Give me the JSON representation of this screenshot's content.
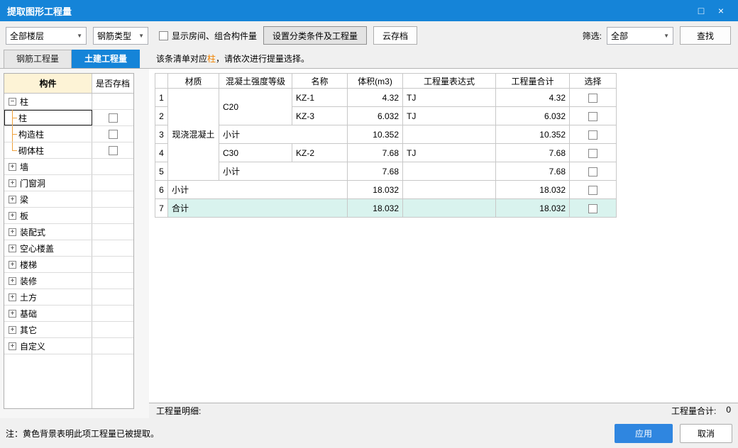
{
  "window": {
    "title": "提取图形工程量"
  },
  "icons": {
    "maximize": "□",
    "close": "×",
    "dropdown_arrow": "▼",
    "collapse": "−",
    "expand": "+"
  },
  "colors": {
    "titlebar_blue": "#1584d8",
    "active_tab_blue": "#1584d8",
    "apply_button_blue": "#2f86e0",
    "component_header_bg": "#fdf3d6",
    "total_row_highlight": "#d9f3ee",
    "tree_connector_orange": "#efa23d",
    "notice_highlight_orange": "#f08200"
  },
  "toolbar": {
    "floor_dropdown": "全部楼层",
    "rebar_dropdown": "钢筋类型",
    "show_checkbox_label": "显示房间、组合构件量",
    "set_category_button": "设置分类条件及工程量",
    "cloud_archive_button": "云存档",
    "filter_label": "筛选:",
    "filter_dropdown": "全部",
    "search_button": "查找"
  },
  "tabs": {
    "rebar": "钢筋工程量",
    "civil": "土建工程量"
  },
  "tree": {
    "col_component": "构件",
    "col_archived": "是否存档",
    "items": [
      {
        "label": "柱"
      },
      {
        "label": "柱"
      },
      {
        "label": "构造柱"
      },
      {
        "label": "砌体柱"
      },
      {
        "label": "墙"
      },
      {
        "label": "门窗洞"
      },
      {
        "label": "梁"
      },
      {
        "label": "板"
      },
      {
        "label": "装配式"
      },
      {
        "label": "空心楼盖"
      },
      {
        "label": "楼梯"
      },
      {
        "label": "装修"
      },
      {
        "label": "土方"
      },
      {
        "label": "基础"
      },
      {
        "label": "其它"
      },
      {
        "label": "自定义"
      }
    ]
  },
  "main": {
    "notice_prefix": "该条清单对应",
    "notice_highlight": "柱",
    "notice_suffix": "，请依次进行提量选择。",
    "table": {
      "headers": [
        "材质",
        "混凝土强度等级",
        "名称",
        "体积(m3)",
        "工程量表达式",
        "工程量合计",
        "选择"
      ],
      "rows": [
        {
          "num": "1",
          "material": "现浇混凝土",
          "grade": "C20",
          "name": "KZ-1",
          "volume": "4.32",
          "expr": "TJ",
          "total": "4.32"
        },
        {
          "num": "2",
          "name": "KZ-3",
          "volume": "6.032",
          "expr": "TJ",
          "total": "6.032"
        },
        {
          "num": "3",
          "label": "小计",
          "volume": "10.352",
          "total": "10.352"
        },
        {
          "num": "4",
          "grade": "C30",
          "name": "KZ-2",
          "volume": "7.68",
          "expr": "TJ",
          "total": "7.68"
        },
        {
          "num": "5",
          "label": "小计",
          "volume": "7.68",
          "total": "7.68"
        },
        {
          "num": "6",
          "label": "小计",
          "volume": "18.032",
          "total": "18.032"
        },
        {
          "num": "7",
          "label": "合计",
          "volume": "18.032",
          "total": "18.032"
        }
      ]
    },
    "footer": {
      "detail_label": "工程量明细:",
      "total_label": "工程量合计:",
      "total_value": "0"
    }
  },
  "bottom": {
    "note": "注：黄色背景表明此项工程量已被提取。",
    "apply_button": "应用",
    "cancel_button": "取消"
  }
}
